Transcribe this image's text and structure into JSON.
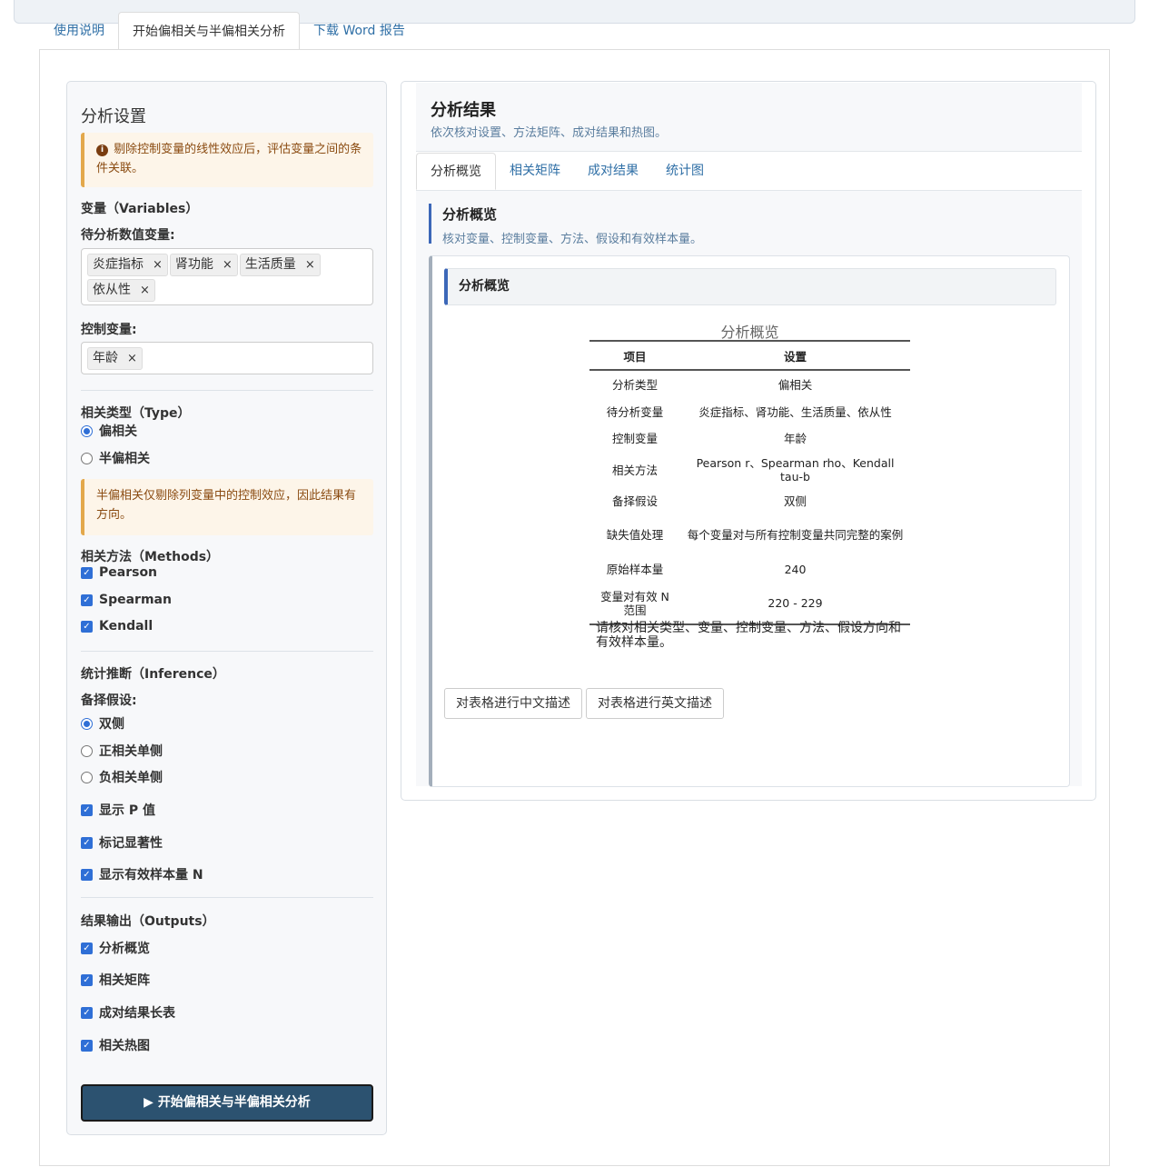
{
  "top_tabs": [
    "使用说明",
    "开始偏相关与半偏相关分析",
    "下载 Word 报告"
  ],
  "sidebar": {
    "title": "分析设置",
    "intro_note": "剔除控制变量的线性效应后，评估变量之间的条件关联。",
    "variables_section": "变量（Variables）",
    "analysis_vars_label": "待分析数值变量:",
    "analysis_vars": [
      "炎症指标",
      "肾功能",
      "生活质量",
      "依从性"
    ],
    "control_vars_label": "控制变量:",
    "control_vars": [
      "年龄"
    ],
    "type_section": "相关类型（Type）",
    "type_options": [
      "偏相关",
      "半偏相关"
    ],
    "type_selected": "偏相关",
    "semi_note": "半偏相关仅剔除列变量中的控制效应，因此结果有方向。",
    "methods_section": "相关方法（Methods）",
    "methods": [
      "Pearson",
      "Spearman",
      "Kendall"
    ],
    "inference_section": "统计推断（Inference）",
    "alt_label": "备择假设:",
    "alt_options": [
      "双侧",
      "正相关单侧",
      "负相关单侧"
    ],
    "alt_selected": "双侧",
    "inference_checks": [
      "显示 P 值",
      "标记显著性",
      "显示有效样本量 N"
    ],
    "outputs_section": "结果输出（Outputs）",
    "outputs": [
      "分析概览",
      "相关矩阵",
      "成对结果长表",
      "相关热图"
    ],
    "run_button": "▶ 开始偏相关与半偏相关分析",
    "remove_symbol": "×",
    "check_symbol": "✓"
  },
  "main": {
    "title": "分析结果",
    "subtitle": "依次核对设置、方法矩阵、成对结果和热图。",
    "tabs": [
      "分析概览",
      "相关矩阵",
      "成对结果",
      "统计图"
    ],
    "overview_title": "分析概览",
    "overview_subtitle": "核对变量、控制变量、方法、假设和有效样本量。",
    "card_title": "分析概览",
    "table_caption": "分析概览",
    "table_headers": [
      "项目",
      "设置"
    ],
    "table_rows": [
      [
        "分析类型",
        "偏相关"
      ],
      [
        "待分析变量",
        "炎症指标、肾功能、生活质量、依从性"
      ],
      [
        "控制变量",
        "年龄"
      ],
      [
        "相关方法",
        "Pearson r、Spearman rho、Kendall tau-b"
      ],
      [
        "备择假设",
        "双侧"
      ],
      [
        "缺失值处理",
        "每个变量对与所有控制变量共同完整的案例"
      ],
      [
        "原始样本量",
        "240"
      ],
      [
        "变量对有效 N 范围",
        "220 - 229"
      ]
    ],
    "table_note": "请核对相关类型、变量、控制变量、方法、假设方向和有效样本量。",
    "btn_cn": "对表格进行中文描述",
    "btn_en": "对表格进行英文描述"
  }
}
